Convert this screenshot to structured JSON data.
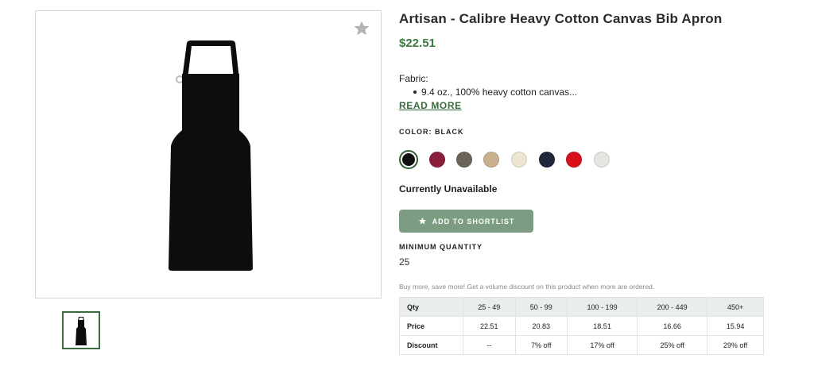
{
  "product": {
    "title": "Artisan - Calibre Heavy Cotton Canvas Bib Apron",
    "price": "$22.51",
    "fabric_label": "Fabric:",
    "fabric_bullet": "9.4 oz., 100% heavy cotton canvas...",
    "read_more": "READ MORE",
    "color_label": "COLOR: BLACK",
    "availability": "Currently Unavailable",
    "shortlist_label": "ADD TO SHORTLIST",
    "min_qty_label": "MINIMUM QUANTITY",
    "min_qty_value": "25",
    "volume_note": "Buy more, save more! Get a volume discount on this product when more are ordered."
  },
  "swatches": [
    {
      "name": "Black",
      "color": "#111111",
      "selected": true
    },
    {
      "name": "Burgundy",
      "color": "#8a1f3c",
      "selected": false
    },
    {
      "name": "Grey",
      "color": "#6b6558",
      "selected": false
    },
    {
      "name": "Tan",
      "color": "#c9b18f",
      "selected": false
    },
    {
      "name": "Natural",
      "color": "#ece6d2",
      "selected": false
    },
    {
      "name": "Navy",
      "color": "#23263a",
      "selected": false
    },
    {
      "name": "Red",
      "color": "#d6111a",
      "selected": false
    },
    {
      "name": "Light Grey",
      "color": "#e4e4e1",
      "selected": false
    }
  ],
  "pricing": {
    "qty": [
      "Qty",
      "25 - 49",
      "50 - 99",
      "100 - 199",
      "200 - 449",
      "450+"
    ],
    "price": [
      "Price",
      "22.51",
      "20.83",
      "18.51",
      "16.66",
      "15.94"
    ],
    "discount": [
      "Discount",
      "--",
      "7% off",
      "17% off",
      "25% off",
      "29% off"
    ]
  },
  "colors": {
    "accent_green": "#3a7a3f",
    "button_green": "#7d9d82",
    "table_header_bg": "#e9eeeb"
  },
  "icons": {
    "favorite": "star-icon",
    "shortlist": "star-icon"
  }
}
